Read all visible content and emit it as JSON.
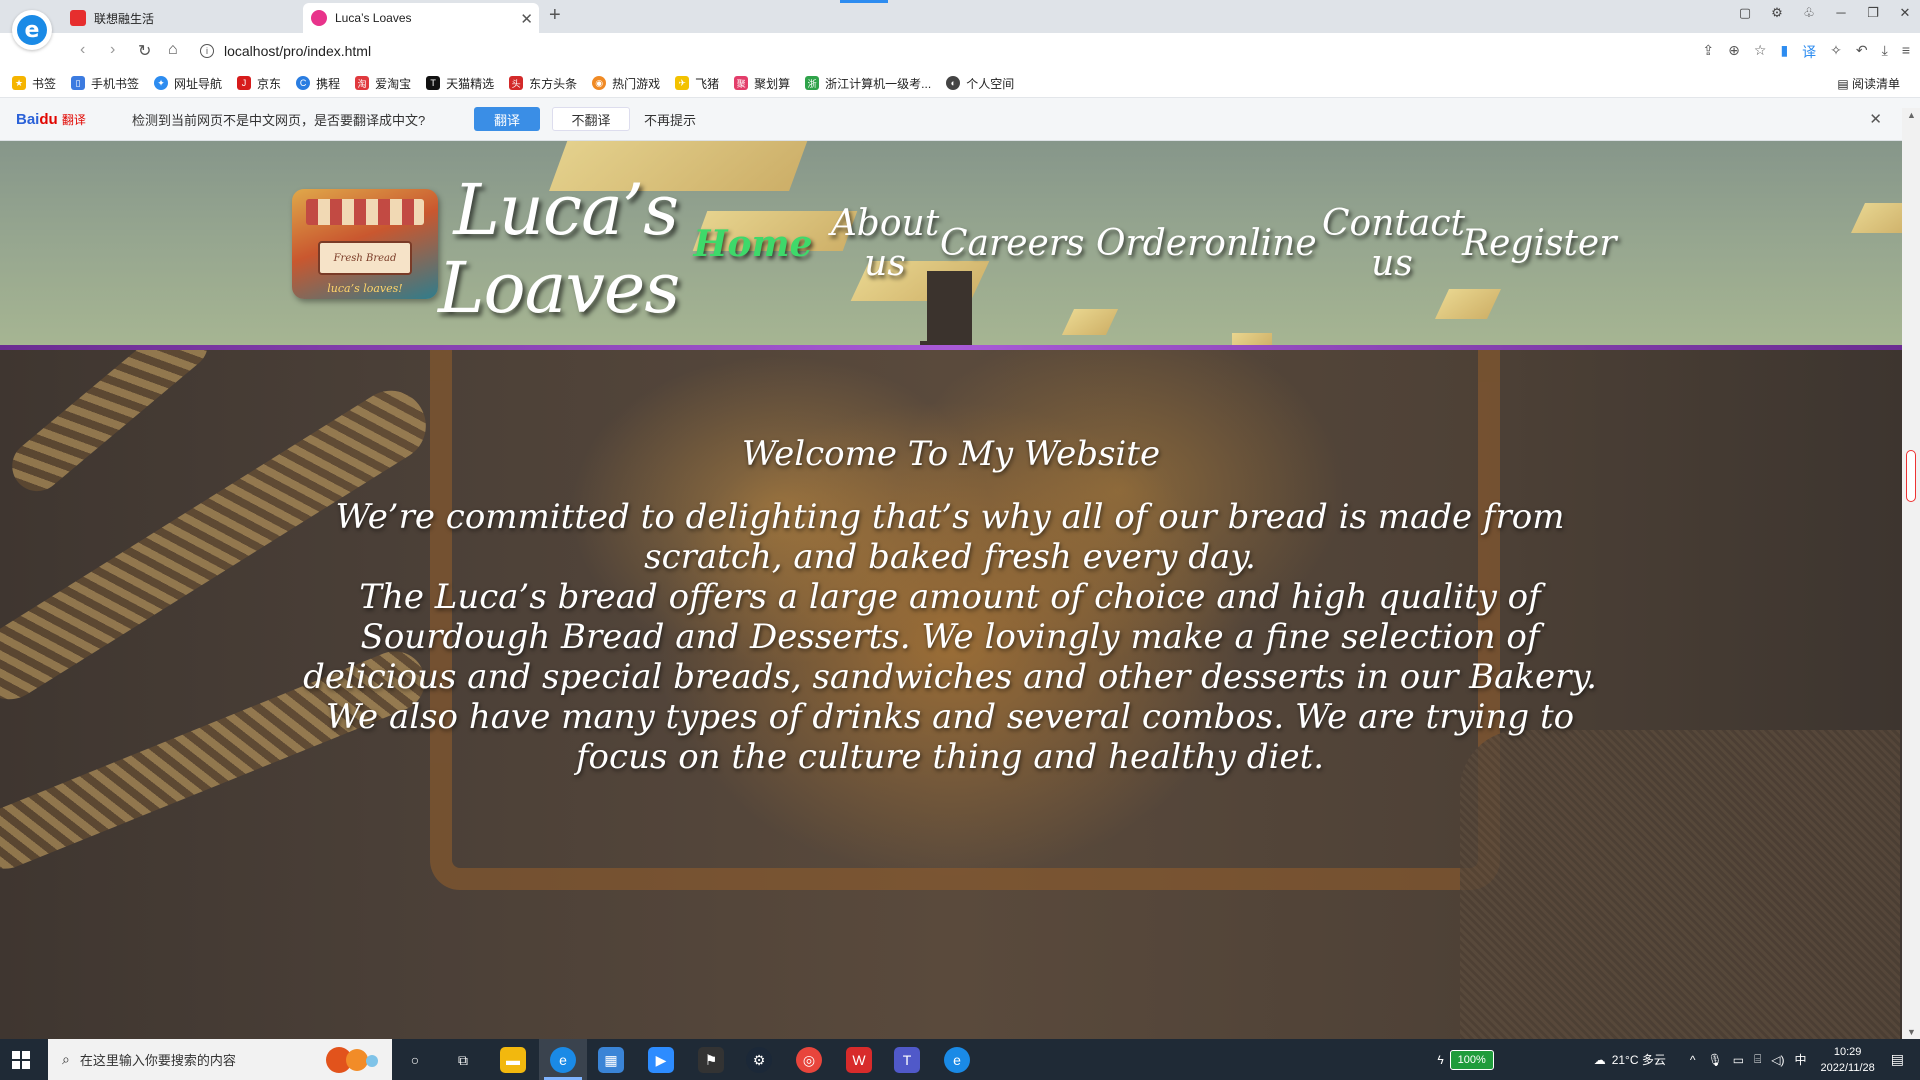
{
  "browser": {
    "tabs": [
      {
        "title": "联想融生活"
      },
      {
        "title": "Luca’s Loaves"
      }
    ],
    "url": "localhost/pro/index.html",
    "bookmarks": [
      "书签",
      "手机书签",
      "网址导航",
      "京东",
      "携程",
      "爱淘宝",
      "天猫精选",
      "东方头条",
      "热门游戏",
      "飞猪",
      "聚划算",
      "浙江计算机一级考...",
      "个人空间"
    ],
    "reading_list": "阅读清单"
  },
  "translate_bar": {
    "logo_bai": "Bai",
    "logo_du": "du",
    "logo_fy": "翻译",
    "message": "检测到当前网页不是中文网页，是否要翻译成中文?",
    "translate": "翻译",
    "no_translate": "不翻译",
    "dont_show": "不再提示"
  },
  "site": {
    "title": "Luca’s Loaves",
    "logo_sign": "Fresh Bread",
    "logo_caption": "luca’s loaves!",
    "nav": {
      "home": "Home",
      "about": "About us",
      "careers": "Careers",
      "order": "Orderonline",
      "contact": "Contact us",
      "register": "Register"
    },
    "welcome_heading": "Welcome To My Website",
    "paragraph1": "We’re committed to delighting that’s why all of our bread is made from scratch, and baked fresh every day.",
    "paragraph2": "The Luca’s bread offers a large amount of choice and high quality of Sourdough Bread and Desserts. We lovingly make a fine selection of delicious and special breads, sandwiches and other desserts in our Bakery. We also have many types of drinks and several combos. We are trying to focus on the culture thing and healthy diet."
  },
  "taskbar": {
    "search_placeholder": "在这里输入你要搜索的内容",
    "battery": "100%",
    "weather": "21°C 多云",
    "ime": "中",
    "time": "10:29",
    "date": "2022/11/28"
  },
  "colors": {
    "nav_active": "#3ed96a",
    "header_border": "#a85ad6",
    "translate_button": "#3a8ee6"
  }
}
